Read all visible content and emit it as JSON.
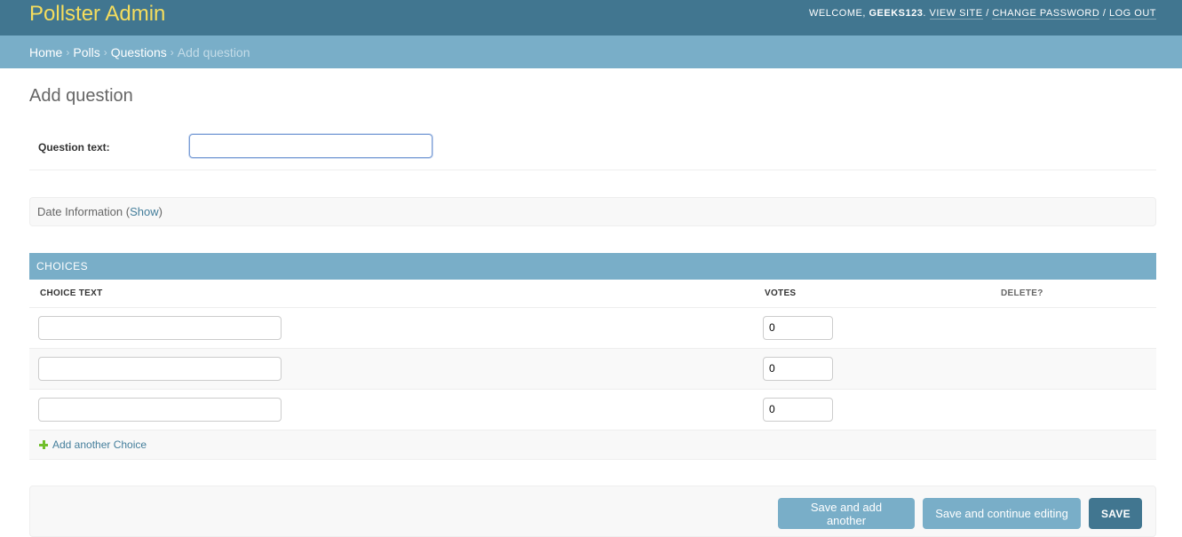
{
  "header": {
    "brand": "Pollster Admin",
    "welcome_prefix": "WELCOME,",
    "username": "GEEKS123",
    "username_suffix": ".",
    "view_site": "VIEW SITE",
    "separator": "/",
    "change_password": "CHANGE PASSWORD",
    "log_out": "LOG OUT"
  },
  "breadcrumbs": {
    "items": [
      "Home",
      "Polls",
      "Questions"
    ],
    "separator": "›",
    "current": "Add question"
  },
  "page": {
    "title": "Add question"
  },
  "question_form": {
    "label": "Question text:",
    "value": ""
  },
  "date_fieldset": {
    "title": "Date Information",
    "open_paren": "(",
    "show_link": "Show",
    "close_paren": ")"
  },
  "choices": {
    "header": "CHOICES",
    "columns": [
      "CHOICE TEXT",
      "VOTES",
      "DELETE?"
    ],
    "rows": [
      {
        "choice_text": "",
        "votes": "0"
      },
      {
        "choice_text": "",
        "votes": "0"
      },
      {
        "choice_text": "",
        "votes": "0"
      }
    ],
    "add_link": "Add another Choice"
  },
  "submit": {
    "save_add_another": "Save and add another",
    "save_continue": "Save and continue editing",
    "save": "SAVE"
  },
  "colors": {
    "header_bg": "#417690",
    "brand_text": "#f5dd5d",
    "breadcrumb_bg": "#79aec8",
    "link": "#447e9b",
    "add_icon": "#70bf2b"
  }
}
